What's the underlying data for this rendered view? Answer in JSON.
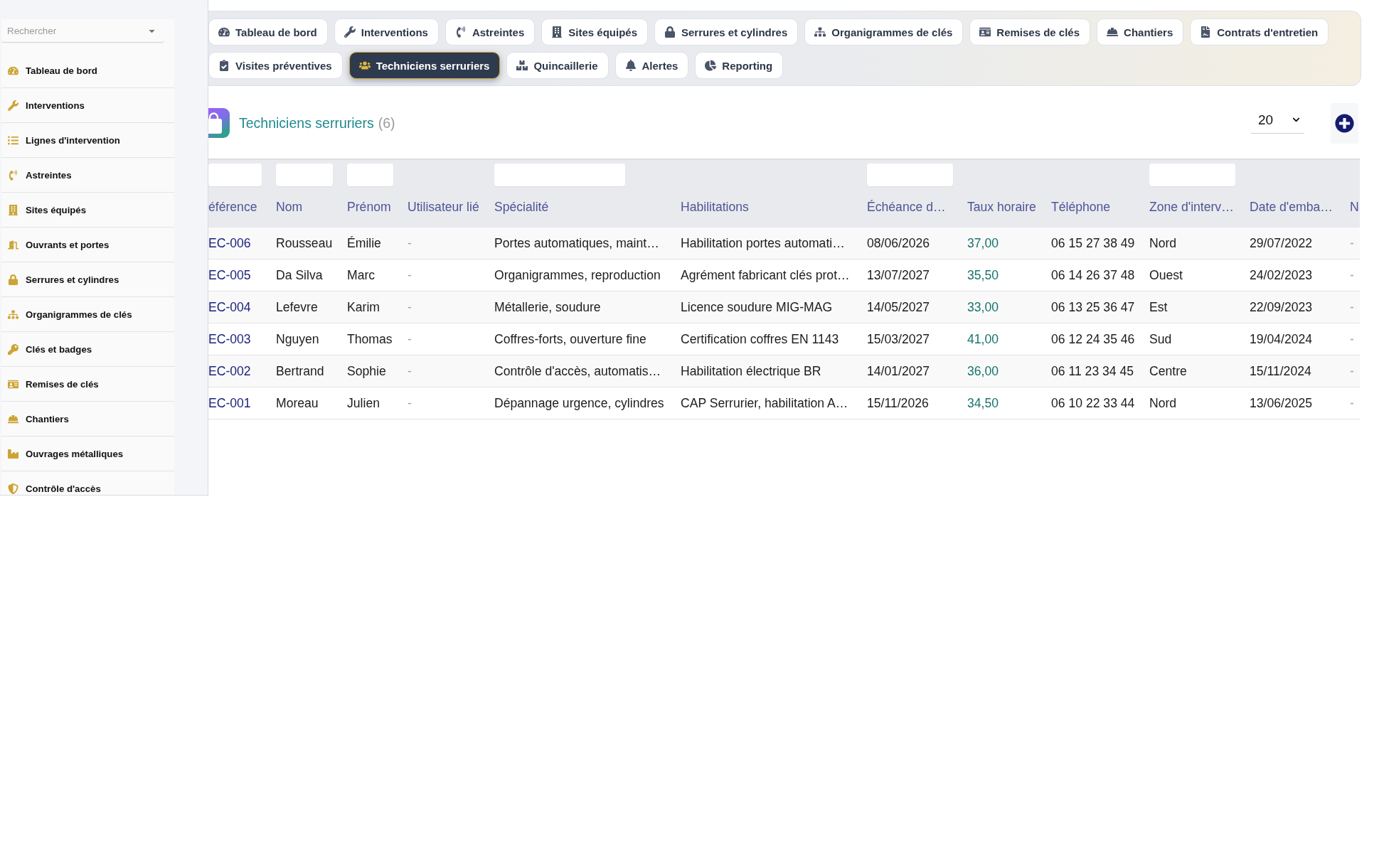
{
  "sidebar": {
    "search": {
      "placeholder": "Rechercher"
    },
    "items": [
      "Tableau de bord",
      "Interventions",
      "Lignes d'intervention",
      "Astreintes",
      "Sites équipés",
      "Ouvrants et portes",
      "Serrures et cylindres",
      "Organigrammes de clés",
      "Clés et badges",
      "Remises de clés",
      "Chantiers",
      "Ouvrages métalliques",
      "Contrôle d'accès"
    ]
  },
  "tabs": [
    {
      "label": "Tableau de bord",
      "selected": false
    },
    {
      "label": "Interventions",
      "selected": false
    },
    {
      "label": "Astreintes",
      "selected": false
    },
    {
      "label": "Sites équipés",
      "selected": false
    },
    {
      "label": "Serrures et cylindres",
      "selected": false
    },
    {
      "label": "Organigrammes de clés",
      "selected": false
    },
    {
      "label": "Remises de clés",
      "selected": false
    },
    {
      "label": "Chantiers",
      "selected": false
    },
    {
      "label": "Contrats d'entretien",
      "selected": false
    },
    {
      "label": "Visites préventives",
      "selected": false
    },
    {
      "label": "Techniciens serruriers",
      "selected": true
    },
    {
      "label": "Quincaillerie",
      "selected": false
    },
    {
      "label": "Alertes",
      "selected": false
    },
    {
      "label": "Reporting",
      "selected": false
    }
  ],
  "page_header": {
    "title": "Techniciens serruriers",
    "count": "(6)",
    "page_size": "20"
  },
  "table": {
    "columns": [
      {
        "label": "éférence",
        "kind": "link",
        "filter": true
      },
      {
        "label": "Nom",
        "kind": "text",
        "filter": true
      },
      {
        "label": "Prénom",
        "kind": "text",
        "filter": true
      },
      {
        "label": "Utilisateur lié",
        "kind": "muted",
        "filter": false
      },
      {
        "label": "Spécialité",
        "kind": "text",
        "filter": true
      },
      {
        "label": "Habilitations",
        "kind": "text",
        "filter": false
      },
      {
        "label": "Échéance d…",
        "kind": "text",
        "filter": true
      },
      {
        "label": "Taux horaire",
        "kind": "rate",
        "filter": false
      },
      {
        "label": "Téléphone",
        "kind": "text",
        "filter": false
      },
      {
        "label": "Zone d'interv…",
        "kind": "text",
        "filter": true
      },
      {
        "label": "Date d'emba…",
        "kind": "text",
        "filter": false
      },
      {
        "label": "N",
        "kind": "muted",
        "filter": false
      }
    ],
    "rows": [
      [
        "EC-006",
        "Rousseau",
        "Émilie",
        "-",
        "Portes automatiques, maint…",
        "Habilitation portes automati…",
        "08/06/2026",
        "37,00",
        "06 15 27 38 49",
        "Nord",
        "29/07/2022",
        "-"
      ],
      [
        "EC-005",
        "Da Silva",
        "Marc",
        "-",
        "Organigrammes, reproduction",
        "Agrément fabricant clés prot…",
        "13/07/2027",
        "35,50",
        "06 14 26 37 48",
        "Ouest",
        "24/02/2023",
        "-"
      ],
      [
        "EC-004",
        "Lefevre",
        "Karim",
        "-",
        "Métallerie, soudure",
        "Licence soudure MIG-MAG",
        "14/05/2027",
        "33,00",
        "06 13 25 36 47",
        "Est",
        "22/09/2023",
        "-"
      ],
      [
        "EC-003",
        "Nguyen",
        "Thomas",
        "-",
        "Coffres-forts, ouverture fine",
        "Certification coffres EN 1143",
        "15/03/2027",
        "41,00",
        "06 12 24 35 46",
        "Sud",
        "19/04/2024",
        "-"
      ],
      [
        "EC-002",
        "Bertrand",
        "Sophie",
        "-",
        "Contrôle d'accès, automatis…",
        "Habilitation électrique BR",
        "14/01/2027",
        "36,00",
        "06 11 23 34 45",
        "Centre",
        "15/11/2024",
        "-"
      ],
      [
        "EC-001",
        "Moreau",
        "Julien",
        "-",
        "Dépannage urgence, cylindres",
        "CAP Serrurier, habilitation A…",
        "15/11/2026",
        "34,50",
        "06 10 22 33 44",
        "Nord",
        "13/06/2025",
        "-"
      ]
    ]
  }
}
